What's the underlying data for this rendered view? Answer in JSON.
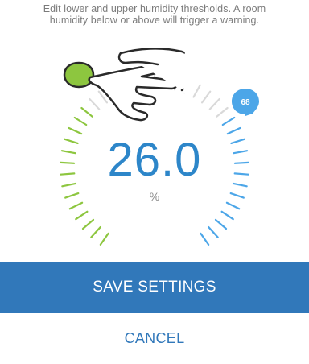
{
  "instruction": {
    "line1": "Edit lower and upper humidity thresholds. A room",
    "line2": "humidity below or above will trigger a warning."
  },
  "gauge": {
    "current_value": "26.0",
    "unit": "%",
    "lower_threshold": "33",
    "upper_threshold": "68",
    "colors": {
      "lower": "#8dc63f",
      "upper": "#4ca6e8",
      "neutral": "#d9d9d9",
      "value": "#2d86c9"
    }
  },
  "gesture": {
    "icon": "pointing-hand-icon"
  },
  "actions": {
    "save_label": "SAVE SETTINGS",
    "cancel_label": "CANCEL",
    "primary_color": "#3178ba"
  }
}
